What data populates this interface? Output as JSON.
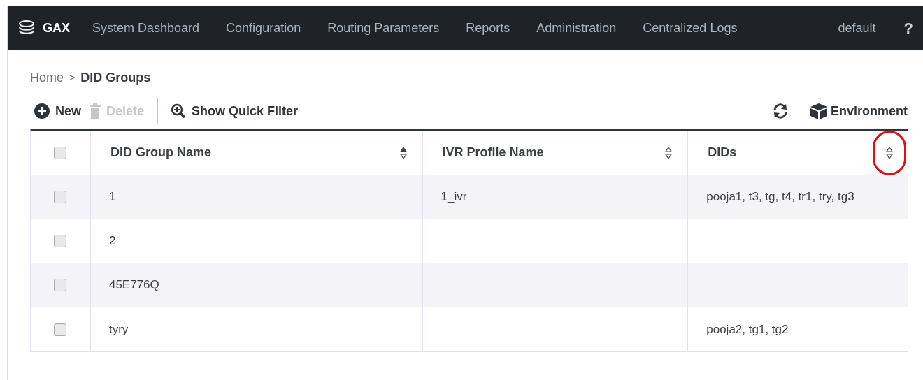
{
  "nav": {
    "logo": "GAX",
    "items": [
      "System Dashboard",
      "Configuration",
      "Routing Parameters",
      "Reports",
      "Administration",
      "Centralized Logs"
    ],
    "user": "default",
    "help": "?"
  },
  "breadcrumb": {
    "home": "Home",
    "separator": ">",
    "current": "DID Groups"
  },
  "toolbar": {
    "left": [
      {
        "kind": "new",
        "label": "New",
        "disabled": false
      },
      {
        "kind": "delete",
        "label": "Delete",
        "disabled": true
      },
      {
        "kind": "filter",
        "label": "Show Quick Filter",
        "disabled": false
      }
    ],
    "environment": "Environment"
  },
  "table": {
    "columns": [
      {
        "label": "DID Group Name",
        "sorted": true,
        "highlighted": false
      },
      {
        "label": "IVR Profile Name",
        "sorted": false,
        "highlighted": false
      },
      {
        "label": "DIDs",
        "sorted": false,
        "highlighted": true
      }
    ],
    "header_checked": false,
    "rows": [
      {
        "checked": false,
        "cells": [
          "1",
          "1_ivr",
          "pooja1, t3, tg, t4, tr1, try, tg3"
        ]
      },
      {
        "checked": false,
        "cells": [
          "2",
          "",
          ""
        ]
      },
      {
        "checked": false,
        "cells": [
          "45E776Q",
          "",
          ""
        ]
      },
      {
        "checked": false,
        "cells": [
          "tyry",
          "",
          "pooja2, tg1, tg2"
        ]
      }
    ]
  }
}
